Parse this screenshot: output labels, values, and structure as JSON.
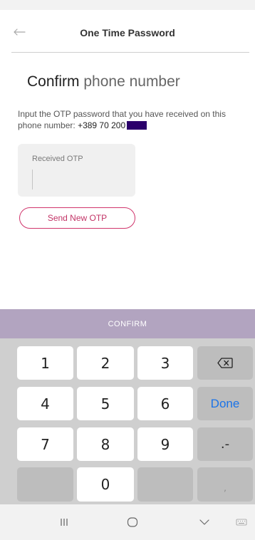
{
  "header": {
    "title": "One Time Password"
  },
  "headline": {
    "strong": "Confirm",
    "light": " phone number"
  },
  "instruction": {
    "text": "Input the OTP password that you have received on this phone number: ",
    "phone": "+389 70 200"
  },
  "otp_field": {
    "label": "Received OTP",
    "value": ""
  },
  "send_new_otp": {
    "label": "Send New OTP"
  },
  "confirm": {
    "label": "CONFIRM"
  },
  "keypad": {
    "keys": [
      "1",
      "2",
      "3",
      "4",
      "5",
      "6",
      "7",
      "8",
      "9",
      "0"
    ],
    "done": "Done",
    "dot_minus": ".-",
    "comma": ","
  },
  "icons": {
    "back": "back-arrow-icon",
    "backspace": "backspace-icon",
    "recent": "recent-apps-icon",
    "home": "home-icon",
    "hide": "hide-keyboard-icon",
    "keyboard": "keyboard-icon"
  },
  "colors": {
    "accent": "#d0356c",
    "confirm_bar": "#b2a4c0",
    "done_text": "#1a73e8",
    "redaction": "#2b006b"
  }
}
